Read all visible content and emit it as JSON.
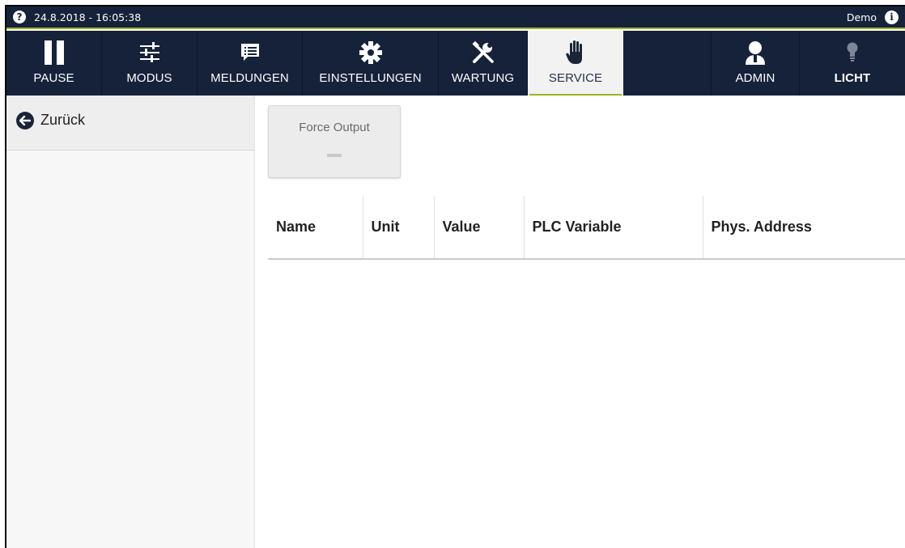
{
  "statusbar": {
    "help_symbol": "?",
    "datetime": "24.8.2018 - 16:05:38",
    "user": "Demo",
    "info_symbol": "i"
  },
  "nav": {
    "items": [
      {
        "label": "PAUSE",
        "icon": "pause-icon"
      },
      {
        "label": "MODUS",
        "icon": "sliders-icon"
      },
      {
        "label": "MELDUNGEN",
        "icon": "messages-icon"
      },
      {
        "label": "EINSTELLUNGEN",
        "icon": "gear-icon"
      },
      {
        "label": "WARTUNG",
        "icon": "tools-icon"
      },
      {
        "label": "SERVICE",
        "icon": "hand-icon",
        "active": true
      },
      {
        "label": "ADMIN",
        "icon": "user-icon"
      },
      {
        "label": "LICHT",
        "icon": "bulb-icon"
      }
    ]
  },
  "sidebar": {
    "back_label": "Zurück"
  },
  "main": {
    "force_output": {
      "label": "Force Output",
      "state_indicator": "—"
    },
    "table": {
      "columns": [
        "Name",
        "Unit",
        "Value",
        "PLC Variable",
        "Phys. Address"
      ],
      "rows": []
    }
  },
  "colors": {
    "nav_bg": "#16223a",
    "accent": "#9bb523",
    "active_tab_bg": "#f2f2f2"
  }
}
